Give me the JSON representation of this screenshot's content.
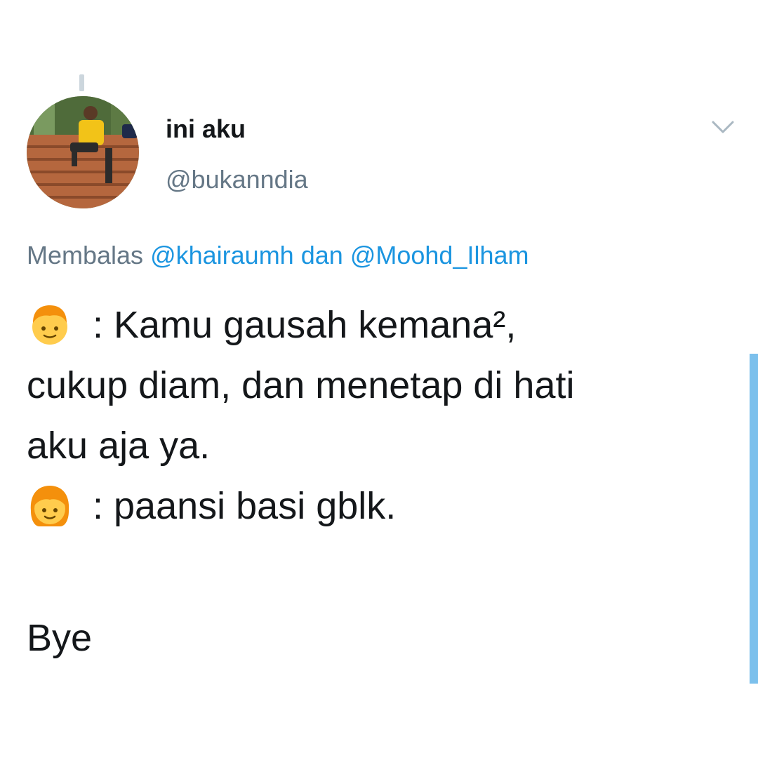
{
  "author": {
    "display_name": "ini aku",
    "handle": "@bukanndia"
  },
  "reply_context": {
    "prefix": "Membalas",
    "mention_1": "@khairaumh",
    "conjunction": "dan",
    "mention_2": "@Moohd_Ilham"
  },
  "tweet": {
    "lines": [
      ": Kamu gausah kemana²,",
      "cukup diam, dan menetap di hati",
      "aku aja ya.",
      ": paansi basi gblk.",
      "",
      "Bye"
    ]
  },
  "icons": {
    "menu": "chevron-down-icon",
    "boy_emoji": "boy-emoji-icon",
    "girl_emoji": "girl-emoji-icon"
  },
  "colors": {
    "text": "#14171a",
    "secondary": "#657786",
    "link": "#1b95e0",
    "scrollbar": "#7cc0ec"
  }
}
